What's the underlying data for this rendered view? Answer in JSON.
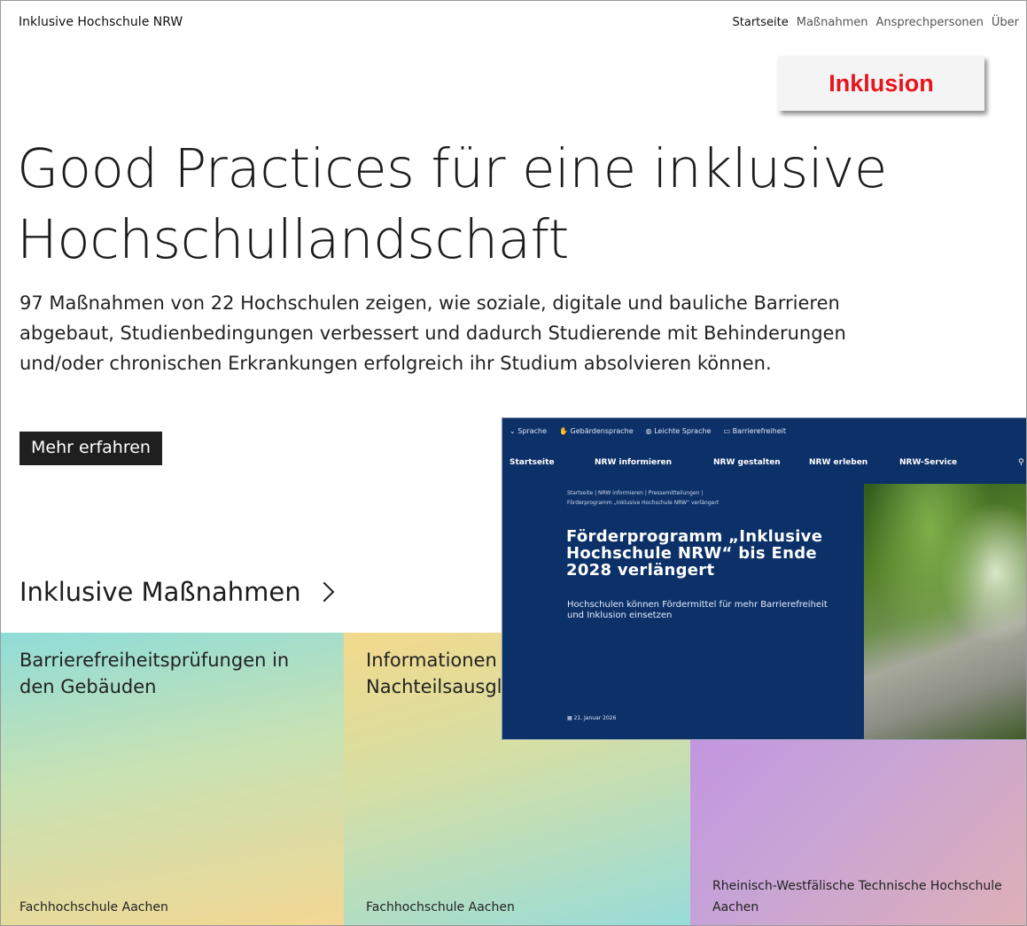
{
  "header": {
    "site_title": "Inklusive Hochschule NRW",
    "nav": [
      "Startseite",
      "Maßnahmen",
      "Ansprechpersonen",
      "Über"
    ]
  },
  "badge": {
    "text": "Inklusion",
    "color": "#e8141c"
  },
  "hero": {
    "title": "Good Practices für eine inklusive Hochschullandschaft",
    "text": "97 Maßnahmen von 22 Hochschulen zeigen, wie soziale, digitale und bauliche Barrieren abgebaut, Studienbedingungen verbessert und dadurch Studierende mit Behinderungen und/oder chronischen Erkrankungen erfolgreich ihr Studium absolvieren können.",
    "button": "Mehr erfahren"
  },
  "section": {
    "title": "Inklusive Maßnahmen",
    "icon": "chevron-right-icon"
  },
  "tiles": [
    {
      "title": "Barrierefreiheitsprüfungen in den Gebäuden",
      "school": "Fachhochschule Aachen"
    },
    {
      "title": "Informationen zum Nachteilsausgleich",
      "school": "Fachhochschule Aachen"
    },
    {
      "title": "",
      "school": "Rheinisch-Westfälische Technische Hochschule Aachen"
    }
  ],
  "overlay": {
    "util_links": [
      "Sprache",
      "Gebärdensprache",
      "Leichte Sprache",
      "Barrierefreiheit"
    ],
    "nav": [
      "Startseite",
      "NRW informieren",
      "NRW gestalten",
      "NRW erleben",
      "NRW-Service"
    ],
    "breadcrumb_line1": "Startseite | NRW informieren | Pressemitteilungen |",
    "breadcrumb_line2": "Förderprogramm „Inklusive Hochschule NRW“ verlängert",
    "headline": "Förderprogramm „Inklusive Hochschule NRW“ bis Ende 2028 verlängert",
    "subline": "Hochschulen können Fördermittel für mehr Barrierefreiheit und Inklusion einsetzen",
    "date": "21. Januar 2026",
    "bg_color": "#0c3169"
  }
}
